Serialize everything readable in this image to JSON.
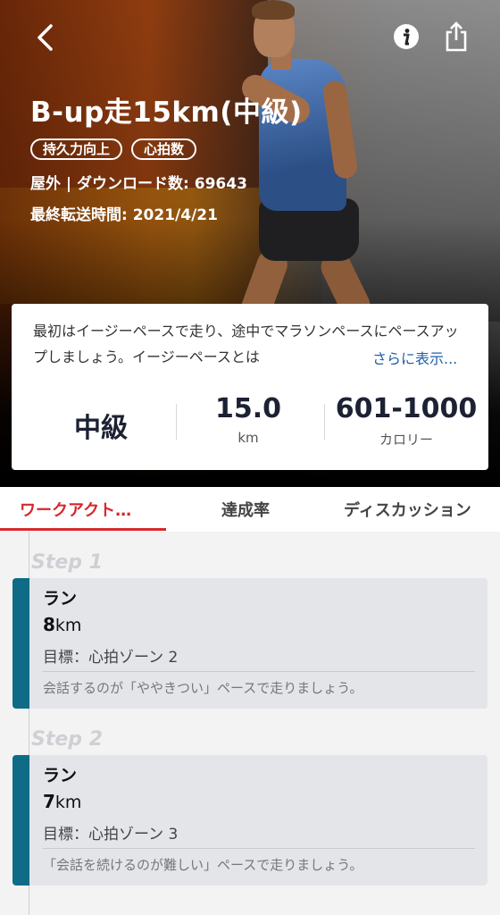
{
  "header": {
    "title": "B-up走15km(中級)",
    "tags": [
      "持久力向上",
      "心拍数"
    ],
    "meta_line": "屋外 | ダウンロード数: 69643",
    "sync_line": "最終転送時間: 2021/4/21"
  },
  "icons": {
    "back": "chevron-left-icon",
    "info": "info-icon",
    "share": "share-icon"
  },
  "description": {
    "text": "最初はイージーペースで走り、途中でマラソンペースにペースアップしましょう。イージーペースとは",
    "more_label": "さらに表示..."
  },
  "stats": [
    {
      "value": "中級",
      "unit": ""
    },
    {
      "value": "15.0",
      "unit": "km"
    },
    {
      "value": "601-1000",
      "unit": "カロリー"
    }
  ],
  "tabs": [
    "ワークアクト…",
    "達成率",
    "ディスカッション"
  ],
  "steps": [
    {
      "label": "Step 1",
      "name": "ラン",
      "distance_value": "8",
      "distance_unit": "km",
      "target": "目標：心拍ゾーン 2",
      "note": "会話するのが「ややきつい」ペースで走りましょう。"
    },
    {
      "label": "Step 2",
      "name": "ラン",
      "distance_value": "7",
      "distance_unit": "km",
      "target": "目標：心拍ゾーン 3",
      "note": "「会話を続けるのが難しい」ペースで走りましょう。"
    }
  ],
  "colors": {
    "accent_red": "#d9262b",
    "step_bar": "#0f6c86",
    "link_blue": "#1f5fa8"
  }
}
